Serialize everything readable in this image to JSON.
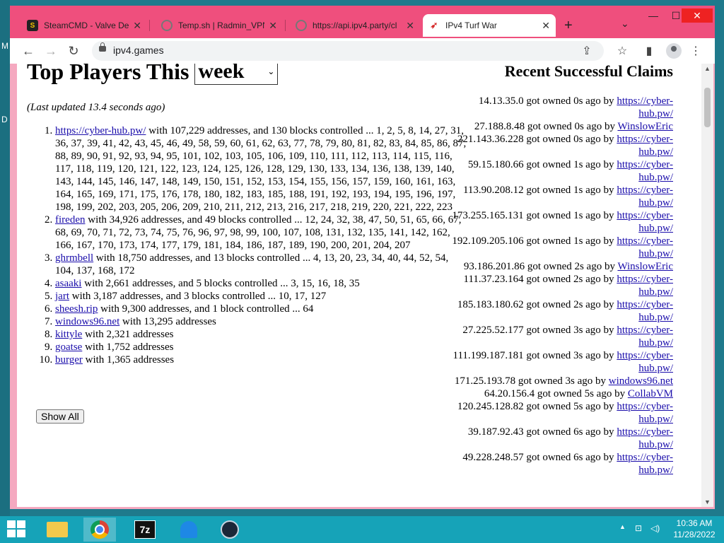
{
  "browser": {
    "tabs": [
      {
        "title": "SteamCMD - Valve Dev",
        "icon": "steamcmd-icon"
      },
      {
        "title": "Temp.sh | Radmin_VPN_",
        "icon": "globe-icon"
      },
      {
        "title": "https://api.ipv4.party/cl",
        "icon": "globe-icon"
      },
      {
        "title": "IPv4 Turf War",
        "icon": "ipv4-bird-icon"
      }
    ],
    "address": "ipv4.games"
  },
  "page": {
    "heading": "Top Players This",
    "period": "week",
    "updated": "(Last updated 13.4 seconds ago)",
    "players": [
      {
        "name": "https://cyber-hub.pw/",
        "text": " with 107,229 addresses, and 130 blocks controlled ... 1, 2, 5, 8, 14, 27, 31, 36, 37, 39, 41, 42, 43, 45, 46, 49, 58, 59, 60, 61, 62, 63, 77, 78, 79, 80, 81, 82, 83, 84, 85, 86, 87, 88, 89, 90, 91, 92, 93, 94, 95, 101, 102, 103, 105, 106, 109, 110, 111, 112, 113, 114, 115, 116, 117, 118, 119, 120, 121, 122, 123, 124, 125, 126, 128, 129, 130, 133, 134, 136, 138, 139, 140, 143, 144, 145, 146, 147, 148, 149, 150, 151, 152, 153, 154, 155, 156, 157, 159, 160, 161, 163, 164, 165, 169, 171, 175, 176, 178, 180, 182, 183, 185, 188, 191, 192, 193, 194, 195, 196, 197, 198, 199, 202, 203, 205, 206, 209, 210, 211, 212, 213, 216, 217, 218, 219, 220, 221, 222, 223"
      },
      {
        "name": "fireden",
        "text": " with 34,926 addresses, and 49 blocks controlled ... 12, 24, 32, 38, 47, 50, 51, 65, 66, 67, 68, 69, 70, 71, 72, 73, 74, 75, 76, 96, 97, 98, 99, 100, 107, 108, 131, 132, 135, 141, 142, 162, 166, 167, 170, 173, 174, 177, 179, 181, 184, 186, 187, 189, 190, 200, 201, 204, 207"
      },
      {
        "name": "ghrmbell",
        "text": " with 18,750 addresses, and 13 blocks controlled ... 4, 13, 20, 23, 34, 40, 44, 52, 54, 104, 137, 168, 172"
      },
      {
        "name": "asaaki",
        "text": " with 2,661 addresses, and 5 blocks controlled ... 3, 15, 16, 18, 35"
      },
      {
        "name": "jart",
        "text": " with 3,187 addresses, and 3 blocks controlled ... 10, 17, 127"
      },
      {
        "name": "sheesh.rip",
        "text": " with 9,300 addresses, and 1 block controlled ... 64"
      },
      {
        "name": "windows96.net",
        "text": " with 13,295 addresses"
      },
      {
        "name": "kittyle",
        "text": " with 2,321 addresses"
      },
      {
        "name": "goatse",
        "text": " with 1,752 addresses"
      },
      {
        "name": "burger",
        "text": " with 1,365 addresses"
      }
    ],
    "show_all": "Show All",
    "claims_title": "Recent Successful Claims",
    "claims": [
      {
        "text": "14.13.35.0 got owned 0s ago by ",
        "user": "https://cyber-hub.pw/"
      },
      {
        "text": "27.188.8.48 got owned 0s ago by ",
        "user": "WinslowEric"
      },
      {
        "text": "221.143.36.228 got owned 0s ago by ",
        "user": "https://cyber-hub.pw/"
      },
      {
        "text": "59.15.180.66 got owned 1s ago by ",
        "user": "https://cyber-hub.pw/"
      },
      {
        "text": "113.90.208.12 got owned 1s ago by ",
        "user": "https://cyber-hub.pw/"
      },
      {
        "text": "173.255.165.131 got owned 1s ago by ",
        "user": "https://cyber-hub.pw/"
      },
      {
        "text": "192.109.205.106 got owned 1s ago by ",
        "user": "https://cyber-hub.pw/"
      },
      {
        "text": "93.186.201.86 got owned 2s ago by ",
        "user": "WinslowEric"
      },
      {
        "text": "111.37.23.164 got owned 2s ago by ",
        "user": "https://cyber-hub.pw/"
      },
      {
        "text": "185.183.180.62 got owned 2s ago by ",
        "user": "https://cyber-hub.pw/"
      },
      {
        "text": "27.225.52.177 got owned 3s ago by ",
        "user": "https://cyber-hub.pw/"
      },
      {
        "text": "111.199.187.181 got owned 3s ago by ",
        "user": "https://cyber-hub.pw/"
      },
      {
        "text": "171.25.193.78 got owned 3s ago by ",
        "user": "windows96.net"
      },
      {
        "text": "64.20.156.4 got owned 5s ago by ",
        "user": "CollabVM"
      },
      {
        "text": "120.245.128.82 got owned 5s ago by ",
        "user": "https://cyber-hub.pw/"
      },
      {
        "text": "39.187.92.43 got owned 6s ago by ",
        "user": "https://cyber-hub.pw/"
      },
      {
        "text": "49.228.248.57 got owned 6s ago by ",
        "user": "https://cyber-hub.pw/"
      }
    ]
  },
  "taskbar": {
    "time": "10:36 AM",
    "date": "11/28/2022"
  }
}
